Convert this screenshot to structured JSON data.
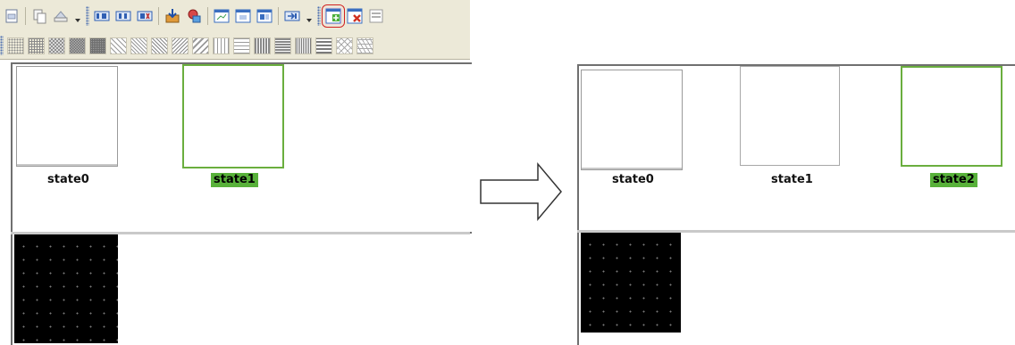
{
  "left": {
    "states": [
      {
        "label": "state0",
        "active": false
      },
      {
        "label": "state1",
        "active": true
      }
    ]
  },
  "right": {
    "states": [
      {
        "label": "state0",
        "active": false
      },
      {
        "label": "state1",
        "active": false
      },
      {
        "label": "state2",
        "active": true
      }
    ]
  },
  "toolbar": {
    "row1_icons": [
      "page-icon",
      "document-icon",
      "copy-icon",
      "print-icon",
      "align-left-icon",
      "align-center-icon",
      "align-right-icon",
      "import-icon",
      "object-icon",
      "window-icon",
      "window-copy-icon",
      "window-edit-icon",
      "jump-icon",
      "add-state-icon",
      "delete-state-icon",
      "state-list-icon"
    ],
    "selected_icon": "add-state-icon",
    "row2_patterns": [
      "dense-dots",
      "grid",
      "checker",
      "dark-checker",
      "dark-grid",
      "diagonal-down",
      "diagonal-down-thin",
      "diagonal-cross",
      "diagonal-up",
      "diagonal-up-thin",
      "vertical-lines",
      "horizontal-lines",
      "vertical-thick",
      "horizontal-thick",
      "vertical-dense",
      "horizontal-dense",
      "diamond",
      "weave"
    ]
  },
  "colors": {
    "active_green": "#58b13a",
    "active_border": "#6aae3e",
    "selected_outline": "#d02020",
    "toolbar_bg": "#ece9d8"
  }
}
